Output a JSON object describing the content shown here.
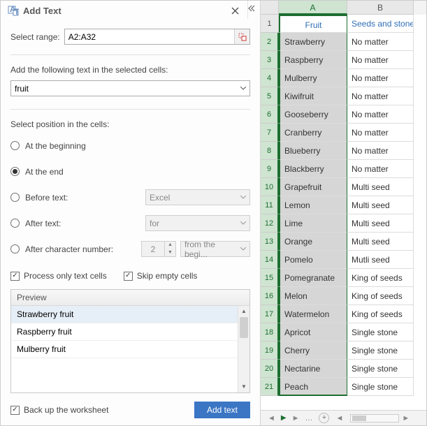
{
  "pane": {
    "title": "Add Text",
    "range_label": "Select range:",
    "range_value": "A2:A32",
    "section_add_label": "Add the following text in the selected cells:",
    "text_value": "fruit",
    "section_pos_label": "Select position in the cells:",
    "radios": {
      "begin": "At the beginning",
      "end": "At the end",
      "before": "Before text:",
      "after": "After text:",
      "charnum": "After character number:"
    },
    "before_value": "Excel",
    "after_value": "for",
    "charnum_value": "2",
    "charnum_combo": "from the begi...",
    "check_text_cells": "Process only text cells",
    "check_skip_empty": "Skip empty cells",
    "preview_header": "Preview",
    "preview_rows": [
      "Strawberry  fruit",
      "Raspberry  fruit",
      "Mulberry  fruit"
    ],
    "backup_label": "Back up the worksheet",
    "primary_btn": "Add text"
  },
  "sheet": {
    "columns": [
      "A",
      "B"
    ],
    "headerRow": [
      "Fruit",
      "Seeds and stones"
    ],
    "rows": [
      {
        "n": 2,
        "a": "Strawberry",
        "b": "No matter"
      },
      {
        "n": 3,
        "a": "Raspberry",
        "b": "No matter"
      },
      {
        "n": 4,
        "a": "Mulberry",
        "b": "No matter"
      },
      {
        "n": 5,
        "a": "Kiwifruit",
        "b": "No matter"
      },
      {
        "n": 6,
        "a": "Gooseberry",
        "b": "No matter"
      },
      {
        "n": 7,
        "a": "Cranberry",
        "b": "No matter"
      },
      {
        "n": 8,
        "a": "Blueberry",
        "b": "No matter"
      },
      {
        "n": 9,
        "a": "Blackberry",
        "b": "No matter"
      },
      {
        "n": 10,
        "a": "Grapefruit",
        "b": "Multi seed"
      },
      {
        "n": 11,
        "a": "Lemon",
        "b": "Multi seed"
      },
      {
        "n": 12,
        "a": "Lime",
        "b": "Multi seed"
      },
      {
        "n": 13,
        "a": "Orange",
        "b": "Multi seed"
      },
      {
        "n": 14,
        "a": "Pomelo",
        "b": "Mutli seed"
      },
      {
        "n": 15,
        "a": "Pomegranate",
        "b": "King of seeds"
      },
      {
        "n": 16,
        "a": "Melon",
        "b": "King of seeds"
      },
      {
        "n": 17,
        "a": "Watermelon",
        "b": "King of seeds"
      },
      {
        "n": 18,
        "a": "Apricot",
        "b": "Single stone"
      },
      {
        "n": 19,
        "a": "Cherry",
        "b": "Single stone"
      },
      {
        "n": 20,
        "a": "Nectarine",
        "b": "Single stone"
      },
      {
        "n": 21,
        "a": "Peach",
        "b": "Single stone"
      }
    ]
  }
}
